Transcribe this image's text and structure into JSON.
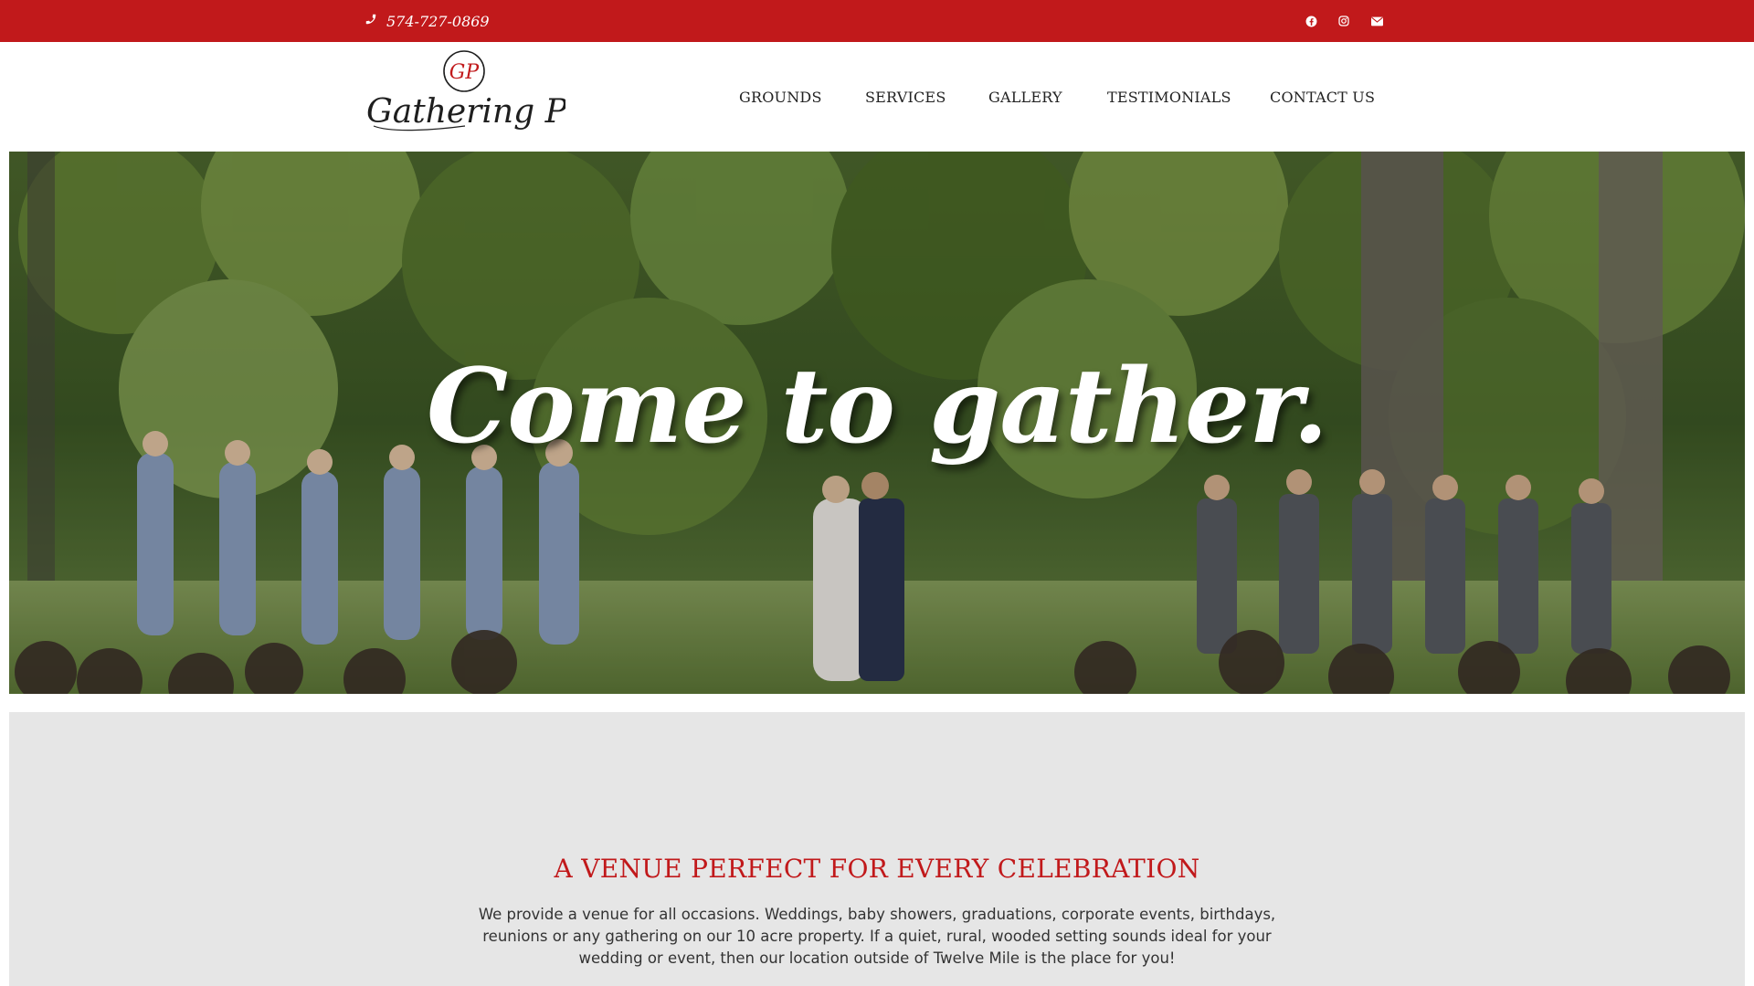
{
  "topbar": {
    "phone": "574-727-0869",
    "social_icons": [
      "facebook-icon",
      "instagram-icon",
      "envelope-icon"
    ],
    "color": "#c1191b"
  },
  "header": {
    "logo_text": "Gathering Place",
    "logo_monogram": "GP",
    "nav": [
      "GROUNDS",
      "SERVICES",
      "GALLERY",
      "TESTIMONIALS",
      "CONTACT US"
    ]
  },
  "hero": {
    "title": "Come to gather."
  },
  "intro": {
    "heading": "A VENUE PERFECT FOR EVERY CELEBRATION",
    "body": "We provide a venue for all occasions. Weddings, baby showers, graduations, corporate events, birthdays, reunions or any gathering on our 10 acre property.  If a quiet, rural, wooded setting sounds ideal for your wedding or event, then our location outside of Twelve Mile is the place for you!",
    "heading_color": "#c1191b",
    "background": "#e6e6e6"
  }
}
